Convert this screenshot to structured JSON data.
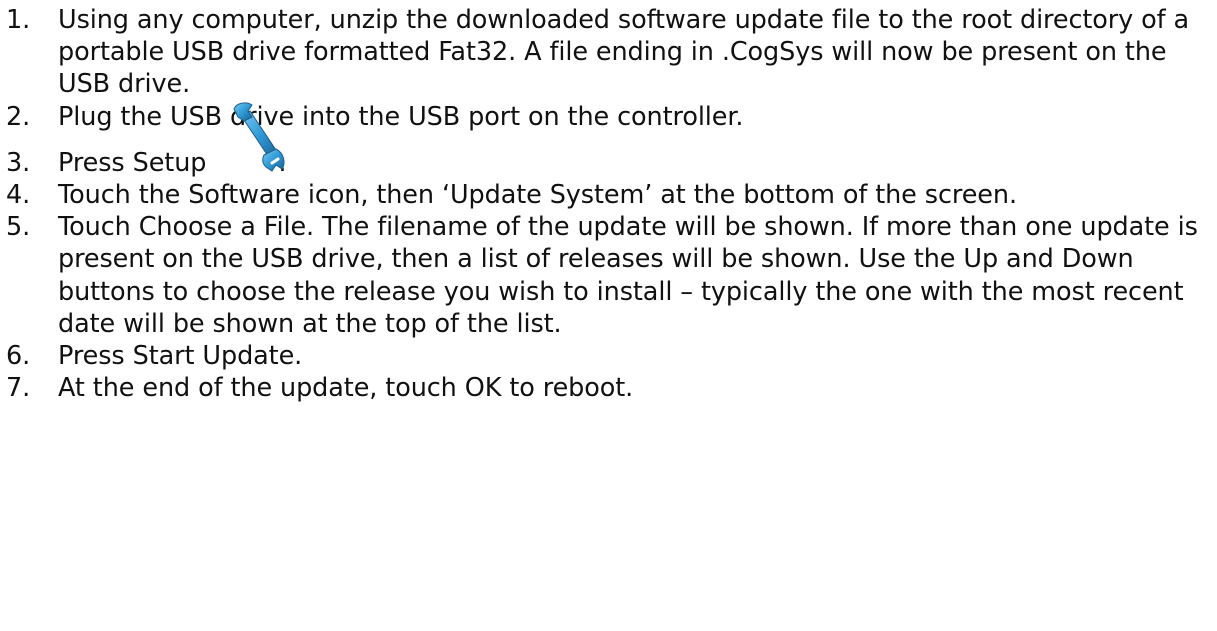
{
  "steps": [
    {
      "number": "1.",
      "text": "Using any computer, unzip the downloaded software update file to the root directory of a portable USB drive formatted Fat32. A file ending in .CogSys will now be present on the USB drive."
    },
    {
      "number": "2.",
      "text": "Plug the USB drive into the USB port on the controller."
    },
    {
      "number": "3.",
      "text": "Press Setup",
      "icon": "wrench-icon",
      "suffix": "."
    },
    {
      "number": "4.",
      "text": "Touch the Software icon, then ‘Update System’ at the bottom of the screen."
    },
    {
      "number": "5.",
      "text": "Touch Choose a File. The filename of the update will be shown. If more than one update is present on the USB drive, then a list of releases will be shown.  Use the Up and Down buttons to choose the release you wish to install – typically the one with the most recent date will be shown at the top of the list."
    },
    {
      "number": "6.",
      "text": "Press Start Update."
    },
    {
      "number": "7.",
      "text": "At the end of the update,  touch OK to reboot."
    }
  ],
  "colors": {
    "text": "#111111",
    "icon_fill": "#2f9ad6",
    "icon_dark": "#1b5f8f"
  }
}
